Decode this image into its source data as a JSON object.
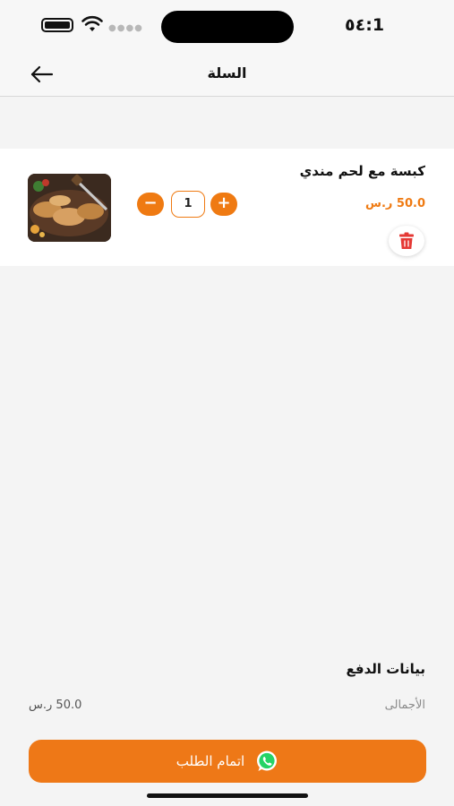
{
  "status_bar": {
    "time": "1:٥٤",
    "battery_icon": "battery-icon",
    "wifi_icon": "wifi-icon",
    "signal_icon": "signal-icon"
  },
  "header": {
    "title": "السلة",
    "back_icon": "arrow-left-icon"
  },
  "cart": {
    "items": [
      {
        "name": "كبسة مع لحم مندي",
        "price": "50.0 ر.س",
        "quantity": "1",
        "minus_label": "−",
        "plus_label": "+",
        "delete_icon": "trash-icon",
        "image_icon": "food-photo"
      }
    ]
  },
  "payment": {
    "title": "بيانات الدفع",
    "total_label": "الأجمالى",
    "total_value": "50.0 ر.س"
  },
  "checkout": {
    "label": "اتمام الطلب",
    "icon": "whatsapp-icon"
  },
  "colors": {
    "accent": "#ef7a12",
    "delete": "#e53935",
    "background": "#f4f4f4"
  }
}
